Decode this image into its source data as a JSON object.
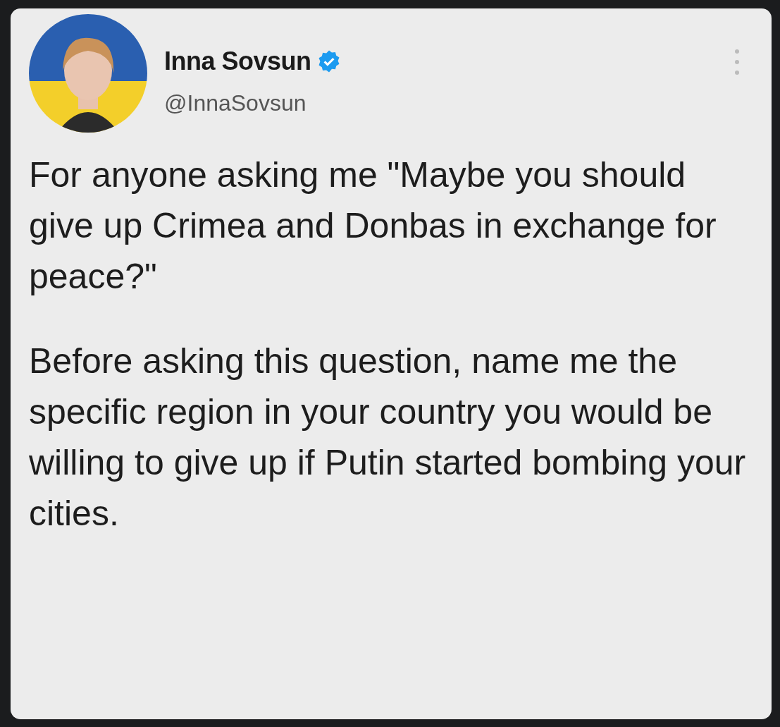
{
  "author": {
    "name": "Inna Sovsun",
    "handle": "@InnaSovsun",
    "verified": true
  },
  "paragraphs": [
    "For anyone asking me \"Maybe you should give up Crimea and Donbas in exchange for peace?\"",
    "Before asking this question, name me the specific region in your country you would be willing to give up if Putin started bombing your cities."
  ]
}
